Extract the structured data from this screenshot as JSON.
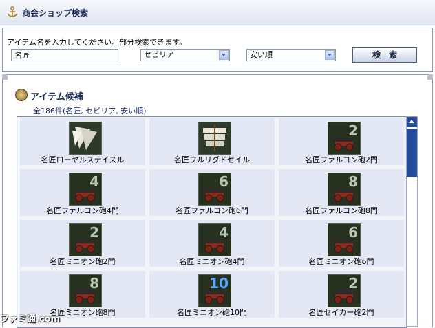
{
  "window": {
    "title": "商会ショップ検索"
  },
  "search": {
    "hint": "アイテム名を入力してください。部分検索できます。",
    "query": "名匠",
    "location_selected": "セビリア",
    "sort_selected": "安い順",
    "button_label": "検　索"
  },
  "results": {
    "heading": "アイテム候補",
    "count_text": "全186件(名匠, セビリア, 安い順)",
    "items": [
      {
        "name": "名匠ローヤルステイスル",
        "icon": "sail-icon",
        "badge": ""
      },
      {
        "name": "名匠フルリグドセイル",
        "icon": "ship-sail-icon",
        "badge": ""
      },
      {
        "name": "名匠ファルコン砲2門",
        "icon": "cannon-icon",
        "badge": "2"
      },
      {
        "name": "名匠ファルコン砲4門",
        "icon": "cannon-icon",
        "badge": "4"
      },
      {
        "name": "名匠ファルコン砲6門",
        "icon": "cannon-icon",
        "badge": "6"
      },
      {
        "name": "名匠ファルコン砲8門",
        "icon": "cannon-icon",
        "badge": "8"
      },
      {
        "name": "名匠ミニオン砲2門",
        "icon": "cannon-icon",
        "badge": "2"
      },
      {
        "name": "名匠ミニオン砲4門",
        "icon": "cannon-icon",
        "badge": "4"
      },
      {
        "name": "名匠ミニオン砲6門",
        "icon": "cannon-icon",
        "badge": "6"
      },
      {
        "name": "名匠ミニオン砲8門",
        "icon": "cannon-icon",
        "badge": "8"
      },
      {
        "name": "名匠ミニオン砲10門",
        "icon": "cannon-icon",
        "badge": "10"
      },
      {
        "name": "名匠セイカー砲2門",
        "icon": "cannon-icon",
        "badge": "2"
      }
    ]
  },
  "watermark": "ファミ通.com",
  "colors": {
    "accent": "#244a9c",
    "cell_bg": "#e4e8f4",
    "title_text": "#1e2a55"
  }
}
